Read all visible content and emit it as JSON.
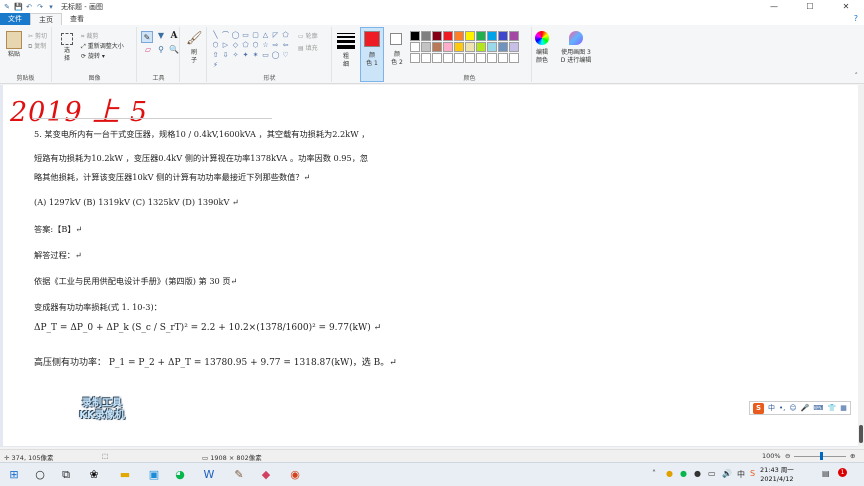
{
  "window": {
    "title": "无标题 - 画图",
    "controls": {
      "minimize": "—",
      "maximize": "☐",
      "close": "✕"
    }
  },
  "tabs": [
    {
      "label": "文件"
    },
    {
      "label": "主页"
    },
    {
      "label": "查看"
    }
  ],
  "ribbon": {
    "clipboard": {
      "paste": "粘贴",
      "cut": "剪切",
      "copy": "复制",
      "group": "剪贴板"
    },
    "image": {
      "select": "选\n择",
      "crop": "裁剪",
      "resize": "重新调整大小",
      "rotate": "旋转",
      "group": "图像"
    },
    "tools": {
      "group": "工具",
      "text_icon": "A"
    },
    "brushes": {
      "label": "刷\n子"
    },
    "shapes": {
      "outline": "轮廓",
      "fill": "填充",
      "group": "形状",
      "icons": [
        "╲",
        "⌒",
        "◯",
        "▭",
        "▢",
        "△",
        "◸",
        "⬠",
        "⬡",
        "▷",
        "◇",
        "⬠",
        "⬡",
        "☆",
        "⇨",
        "⇦",
        "⇧",
        "⇩",
        "✧",
        "✦",
        "✶",
        "▭",
        "◯",
        "♡",
        "⚡"
      ]
    },
    "size": {
      "label": "粗\n细"
    },
    "color1": {
      "label": "颜\n色 1",
      "value": "#ee1c24"
    },
    "color2": {
      "label": "颜\n色 2",
      "value": "#ffffff"
    },
    "colors": {
      "group": "颜色",
      "palette": [
        "#000000",
        "#7f7f7f",
        "#880015",
        "#ed1c24",
        "#ff7f27",
        "#fff200",
        "#22b14c",
        "#00a2e8",
        "#3f48cc",
        "#a349a4",
        "#ffffff",
        "#c3c3c3",
        "#b97a57",
        "#ffaec9",
        "#ffc90e",
        "#efe4b0",
        "#b5e61d",
        "#99d9ea",
        "#7092be",
        "#c8bfe7",
        "#ffffff",
        "#ffffff",
        "#ffffff",
        "#ffffff",
        "#ffffff",
        "#ffffff",
        "#ffffff",
        "#ffffff",
        "#ffffff",
        "#ffffff"
      ]
    },
    "edit_colors": {
      "label": "编辑\n颜色"
    },
    "paint3d": {
      "label": "使用画图 3\nD 进行编辑"
    }
  },
  "canvas": {
    "handwriting": "2019 上 5",
    "lines": [
      "5. 某变电所内有一台干式变压器，规格10 / 0.4kV,1600kVA ，其空载有功损耗为2.2kW ，",
      "短路有功损耗为10.2kW ，变压器0.4kV 侧的计算视在功率1378kVA 。功率因数 0.95，忽",
      "略其他损耗，计算该变压器10kV 侧的计算有功功率最接近下列那些数值？↵",
      "(A)  1297kV     (B)  1319kV   (C)  1325kV   (D)  1390kV ↵",
      "答案:【B】↵",
      "解答过程：↵",
      "依据《工业与民用供配电设计手册》(第四版) 第 30 页↵",
      "变成器有功功率损耗(式  1. 10-3)：",
      "ΔP_T = ΔP_0 + ΔP_k (S_c / S_rT)² = 2.2 + 10.2×(1378/1600)² = 9.77(kW) ↵",
      "高压侧有功功率： P_1 = P_2 + ΔP_T = 13780.95 + 9.77 = 1318.87(kW)，选 B。↵"
    ],
    "watermark": [
      "录制工具",
      "KK录像机"
    ]
  },
  "ime": {
    "logo": "S",
    "mode": "中",
    "items": [
      "•,",
      "☺",
      "🎤",
      "⌨",
      "👕",
      "▦"
    ]
  },
  "status": {
    "cursor": "374, 105像素",
    "image_size": "1908 × 802像素",
    "zoom": "100%"
  },
  "taskbar": {
    "time": "21:43 周一",
    "date": "2021/4/12",
    "notification": "1"
  }
}
